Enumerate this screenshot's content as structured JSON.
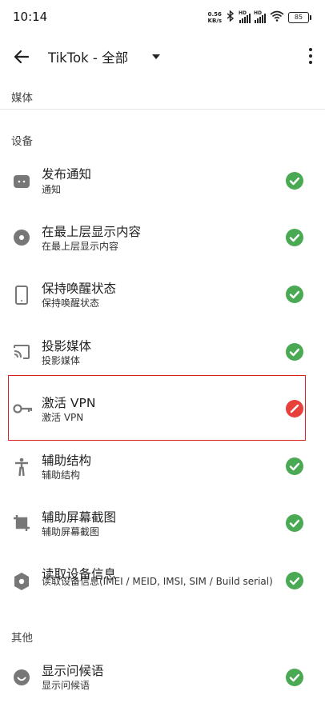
{
  "status_bar": {
    "time": "10:14",
    "net_speed_value": "0.56",
    "net_speed_unit": "KB/s",
    "signal_label_1": "HD",
    "signal_label_2": "HD",
    "battery": "85"
  },
  "app_bar": {
    "title": "TikTok - 全部"
  },
  "sections": {
    "media": "媒体",
    "device": "设备",
    "other": "其他"
  },
  "permissions": [
    {
      "title": "发布通知",
      "subtitle": "通知",
      "icon": "message-icon",
      "state": "granted"
    },
    {
      "title": "在最上层显示内容",
      "subtitle": "在最上层显示内容",
      "icon": "overlay-icon",
      "state": "granted"
    },
    {
      "title": "保持唤醒状态",
      "subtitle": "保持唤醒状态",
      "icon": "phone-icon",
      "state": "granted"
    },
    {
      "title": "投影媒体",
      "subtitle": "投影媒体",
      "icon": "cast-icon",
      "state": "granted"
    },
    {
      "title": "激活 VPN",
      "subtitle": "激活 VPN",
      "icon": "key-icon",
      "state": "denied"
    },
    {
      "title": "辅助结构",
      "subtitle": "辅助结构",
      "icon": "accessibility-icon",
      "state": "granted"
    },
    {
      "title": "辅助屏幕截图",
      "subtitle": "辅助屏幕截图",
      "icon": "crop-icon",
      "state": "granted"
    },
    {
      "title": "读取设备信息",
      "subtitle": "读取设备信息(IMEI / MEID, IMSI, SIM / Build serial)",
      "icon": "hexagon-icon",
      "state": "granted"
    },
    {
      "title": "显示问候语",
      "subtitle": "显示问候语",
      "icon": "smile-icon",
      "state": "granted"
    }
  ],
  "colors": {
    "granted": "#4aaa54",
    "denied": "#e8413b",
    "highlight": "#d92121"
  }
}
